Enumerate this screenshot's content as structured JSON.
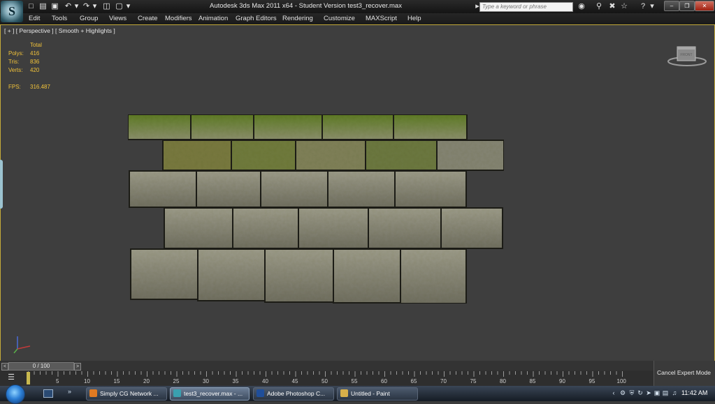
{
  "title_bar": {
    "app_logo": "S",
    "title": "Autodesk 3ds Max  2011 x64   - Student Version    test3_recover.max",
    "search_placeholder": "Type a keyword or phrase",
    "quick_access": [
      "new-file-icon",
      "open-folder-icon",
      "save-icon",
      "undo-icon",
      "redo-icon",
      "project-folder-icon",
      "window-icon"
    ],
    "tool_icons": [
      "binoculars-icon",
      "key-icon",
      "star-icon",
      "favorites-icon",
      "help-icon"
    ]
  },
  "menu": {
    "items": [
      "Edit",
      "Tools",
      "Group",
      "Views",
      "Create",
      "Modifiers",
      "Animation",
      "Graph Editors",
      "Rendering",
      "Customize",
      "MAXScript",
      "Help"
    ]
  },
  "viewport": {
    "label": "[ + ] [ Perspective ] [ Smooth + Highlights ]",
    "stats": {
      "header": "Total",
      "polys_label": "Polys:",
      "polys": "416",
      "tris_label": "Tris:",
      "tris": "836",
      "verts_label": "Verts:",
      "verts": "420",
      "fps_label": "FPS:",
      "fps": "316.487"
    },
    "viewcube_label": "FRONT"
  },
  "timeline": {
    "frame_display": "0 / 100",
    "ticks": [
      "5",
      "10",
      "15",
      "20",
      "25",
      "30",
      "35",
      "40",
      "45",
      "50",
      "55",
      "60",
      "65",
      "70",
      "75",
      "80",
      "85",
      "90",
      "95",
      "100"
    ],
    "current_frame": 0,
    "expert_mode_label": "Cancel Expert Mode"
  },
  "taskbar": {
    "buttons": [
      {
        "label": "Simply CG Network ...",
        "color": "#e07a22",
        "active": false
      },
      {
        "label": "test3_recover.max - ...",
        "color": "#3aa0b0",
        "active": true
      },
      {
        "label": "Adobe Photoshop C...",
        "color": "#1f4e9a",
        "active": false
      },
      {
        "label": "Untitled - Paint",
        "color": "#d8b04a",
        "active": false
      }
    ],
    "clock": "11:42 AM"
  },
  "colors": {
    "viewport_border": "#c4aa3a",
    "stats_text": "#f1c23a",
    "moss": "#6e8a2c",
    "stone": "#8c8c80"
  }
}
